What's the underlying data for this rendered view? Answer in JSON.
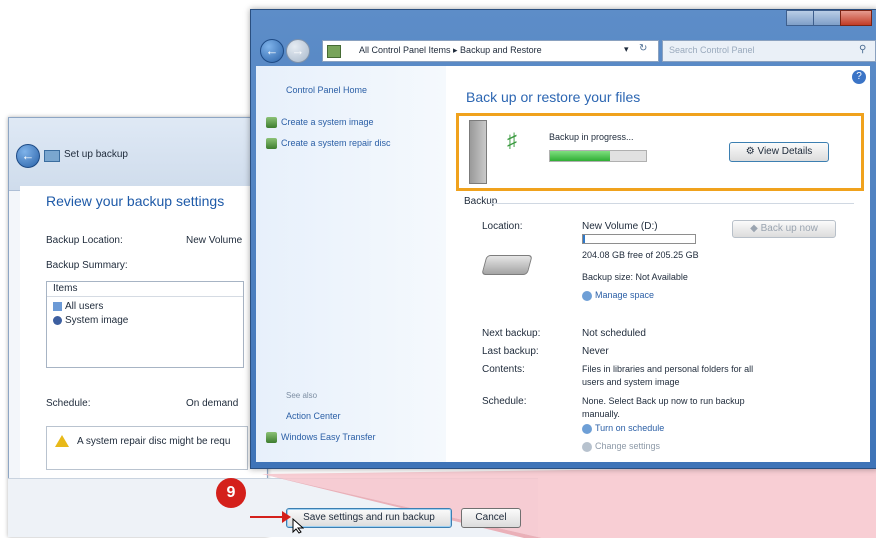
{
  "setup_window": {
    "title": "Set up backup",
    "heading": "Review your backup settings",
    "location_label": "Backup Location:",
    "location_value": "New Volume",
    "summary_label": "Backup Summary:",
    "summary_header": "Items",
    "summary_items": [
      "All users",
      "System image"
    ],
    "schedule_label": "Schedule:",
    "schedule_value": "On demand",
    "warning_text": "A system repair disc might be requ",
    "save_button": "Save settings and run backup",
    "cancel_button": "Cancel"
  },
  "step_badge": "9",
  "main_window": {
    "address_path": "All Control Panel Items ▸ Backup and Restore",
    "search_placeholder": "Search Control Panel",
    "help_icon": "?",
    "nav": {
      "home": "Control Panel Home",
      "links": [
        "Create a system image",
        "Create a system repair disc"
      ],
      "see_also_label": "See also",
      "see_also_links": [
        "Action Center",
        "Windows Easy Transfer"
      ]
    },
    "content": {
      "heading": "Back up or restore your files",
      "progress_text": "Backup in progress...",
      "progress_fraction": 0.62,
      "view_details_button": "View Details",
      "backup_section": "Backup",
      "location_label": "Location:",
      "location_value": "New Volume (D:)",
      "free_space": "204.08 GB free of 205.25 GB",
      "backup_size": "Backup size: Not Available",
      "manage_space": "Manage space",
      "backup_now_button": "Back up now",
      "next_backup_label": "Next backup:",
      "next_backup_value": "Not scheduled",
      "last_backup_label": "Last backup:",
      "last_backup_value": "Never",
      "contents_label": "Contents:",
      "contents_value_1": "Files in libraries and personal folders for all",
      "contents_value_2": "users and system image",
      "schedule_label": "Schedule:",
      "schedule_value_1": "None. Select Back up now to run backup",
      "schedule_value_2": "manually.",
      "turn_on_schedule": "Turn on schedule",
      "change_settings": "Change settings"
    }
  },
  "colors": {
    "highlight": "#f0a21d",
    "badge": "#d4201b",
    "link": "#2b5fa6",
    "callout": "#f7c6cc"
  }
}
